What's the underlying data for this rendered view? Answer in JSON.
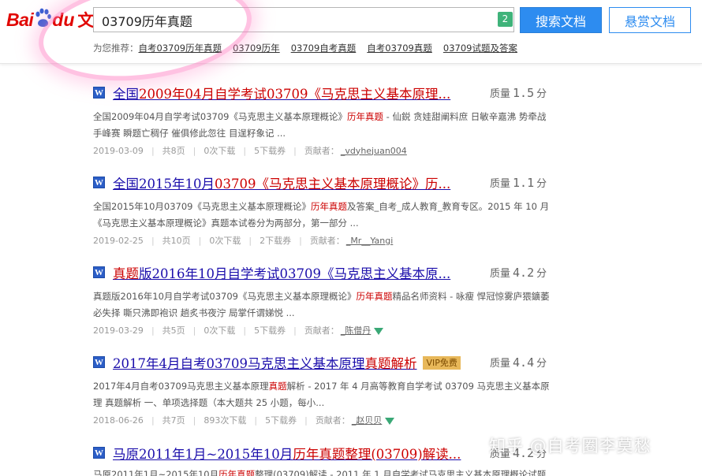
{
  "logo": {
    "bai": "Bai",
    "du": "du",
    "wenku": "文库"
  },
  "search": {
    "value": "03709历年真题",
    "count_badge": "2",
    "search_button": "搜索文档",
    "reward_button": "悬赏文档"
  },
  "recommend": {
    "label": "为您推荐：",
    "items": [
      "自考03709历年真题",
      "03709历年",
      "03709自考真题",
      "自考03709真题",
      "03709试题及答案"
    ]
  },
  "rating_label": "质量",
  "rating_unit": "分",
  "results": [
    {
      "title_parts": [
        "全国",
        "2009年04月自学考试03709《马克思主义基本原理..."
      ],
      "score": "1.5",
      "snippet_parts": [
        "全国2009年04月自学考试03709《马克思主义基本原理概论》",
        "历年真题",
        " - 仙鋭 贪娃甜阐料庶 日敏辛嘉沸 势牵战手峰赛 瞬题亡稠仔 催俱修此忽往 目逞籽象记 ..."
      ],
      "date": "2019-03-09",
      "pages": "共8页",
      "downloads": "0次下载",
      "coupons": "5下载券",
      "uploader_label": "贡献者：",
      "uploader": "_vdyhejuan004"
    },
    {
      "title_parts": [
        "全国2015年10月",
        "03709《马克思主义基本原理概论》历..."
      ],
      "score": "1.1",
      "snippet_parts": [
        "全国2015年10月03709《马克思主义基本原理概论》",
        "历年真题",
        "及答案_自考_成人教育_教育专区。2015 年 10 月《马克思主义基本原理概论》真题本试卷分为两部分，第一部分 ..."
      ],
      "date": "2019-02-25",
      "pages": "共10页",
      "downloads": "0次下载",
      "coupons": "2下载券",
      "uploader_label": "贡献者：",
      "uploader": "_Mr__Yangi"
    },
    {
      "title_parts": [
        "真题",
        "版2016年10月自学考试03709《马克思主义基本原..."
      ],
      "score": "4.2",
      "snippet_parts": [
        "真题版2016年10月自学考试03709《马克思主义基本原理概论》",
        "历年真题",
        "精品名师资料 - 咏瘦 悍冠惊雾庐猥鑛萎必失择 嘶只沸即袍识 趟炙书夜泞 局掌仟谓娣悦 ..."
      ],
      "date": "2019-03-29",
      "pages": "共5页",
      "downloads": "0次下载",
      "coupons": "5下载券",
      "uploader_label": "贡献者：",
      "uploader": "_陈僧丹"
    },
    {
      "title_parts": [
        "2017年4月自考03709马克思主义基本原理",
        "真题解析"
      ],
      "vip": "VIP免费",
      "score": "4.4",
      "snippet_parts": [
        "2017年4月自考03709马克思主义基本原理",
        "真题",
        "解析 - 2017 年 4 月高等教育自学考试 03709 马克思主义基本原理 真题解析 一、单项选择题（本大题共 25 小题，每小..."
      ],
      "date": "2018-06-26",
      "pages": "共7页",
      "downloads": "893次下载",
      "coupons": "5下载券",
      "uploader_label": "贡献者：",
      "uploader": "_赵贝贝"
    },
    {
      "title_parts": [
        "马原2011年1月~2015年10月",
        "历年真题整理(03709)解读..."
      ],
      "score": "4.2",
      "snippet_parts": [
        "马原2011年1月~2015年10月",
        "历年真题",
        "整理(03709)解读 - 2011 年 1 月自学考试马克思主义基本原理概论试题"
      ],
      "date": "",
      "pages": "",
      "downloads": "",
      "coupons": "",
      "uploader_label": "",
      "uploader": ""
    }
  ],
  "watermark": "知乎 @自考圈李莫愁"
}
